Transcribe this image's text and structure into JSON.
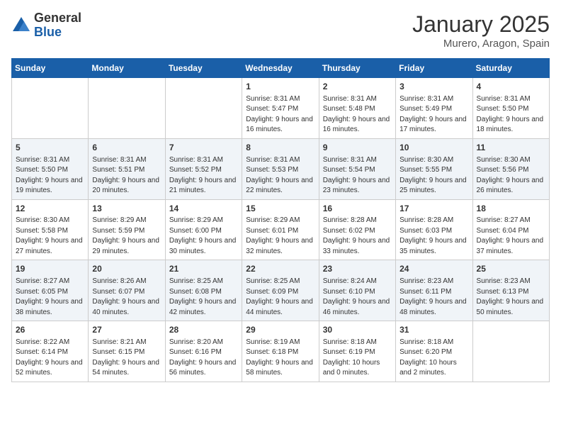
{
  "logo": {
    "general": "General",
    "blue": "Blue"
  },
  "title": {
    "month": "January 2025",
    "location": "Murero, Aragon, Spain"
  },
  "days_of_week": [
    "Sunday",
    "Monday",
    "Tuesday",
    "Wednesday",
    "Thursday",
    "Friday",
    "Saturday"
  ],
  "weeks": [
    [
      {
        "day": "",
        "sunrise": "",
        "sunset": "",
        "daylight": ""
      },
      {
        "day": "",
        "sunrise": "",
        "sunset": "",
        "daylight": ""
      },
      {
        "day": "",
        "sunrise": "",
        "sunset": "",
        "daylight": ""
      },
      {
        "day": "1",
        "sunrise": "Sunrise: 8:31 AM",
        "sunset": "Sunset: 5:47 PM",
        "daylight": "Daylight: 9 hours and 16 minutes."
      },
      {
        "day": "2",
        "sunrise": "Sunrise: 8:31 AM",
        "sunset": "Sunset: 5:48 PM",
        "daylight": "Daylight: 9 hours and 16 minutes."
      },
      {
        "day": "3",
        "sunrise": "Sunrise: 8:31 AM",
        "sunset": "Sunset: 5:49 PM",
        "daylight": "Daylight: 9 hours and 17 minutes."
      },
      {
        "day": "4",
        "sunrise": "Sunrise: 8:31 AM",
        "sunset": "Sunset: 5:50 PM",
        "daylight": "Daylight: 9 hours and 18 minutes."
      }
    ],
    [
      {
        "day": "5",
        "sunrise": "Sunrise: 8:31 AM",
        "sunset": "Sunset: 5:50 PM",
        "daylight": "Daylight: 9 hours and 19 minutes."
      },
      {
        "day": "6",
        "sunrise": "Sunrise: 8:31 AM",
        "sunset": "Sunset: 5:51 PM",
        "daylight": "Daylight: 9 hours and 20 minutes."
      },
      {
        "day": "7",
        "sunrise": "Sunrise: 8:31 AM",
        "sunset": "Sunset: 5:52 PM",
        "daylight": "Daylight: 9 hours and 21 minutes."
      },
      {
        "day": "8",
        "sunrise": "Sunrise: 8:31 AM",
        "sunset": "Sunset: 5:53 PM",
        "daylight": "Daylight: 9 hours and 22 minutes."
      },
      {
        "day": "9",
        "sunrise": "Sunrise: 8:31 AM",
        "sunset": "Sunset: 5:54 PM",
        "daylight": "Daylight: 9 hours and 23 minutes."
      },
      {
        "day": "10",
        "sunrise": "Sunrise: 8:30 AM",
        "sunset": "Sunset: 5:55 PM",
        "daylight": "Daylight: 9 hours and 25 minutes."
      },
      {
        "day": "11",
        "sunrise": "Sunrise: 8:30 AM",
        "sunset": "Sunset: 5:56 PM",
        "daylight": "Daylight: 9 hours and 26 minutes."
      }
    ],
    [
      {
        "day": "12",
        "sunrise": "Sunrise: 8:30 AM",
        "sunset": "Sunset: 5:58 PM",
        "daylight": "Daylight: 9 hours and 27 minutes."
      },
      {
        "day": "13",
        "sunrise": "Sunrise: 8:29 AM",
        "sunset": "Sunset: 5:59 PM",
        "daylight": "Daylight: 9 hours and 29 minutes."
      },
      {
        "day": "14",
        "sunrise": "Sunrise: 8:29 AM",
        "sunset": "Sunset: 6:00 PM",
        "daylight": "Daylight: 9 hours and 30 minutes."
      },
      {
        "day": "15",
        "sunrise": "Sunrise: 8:29 AM",
        "sunset": "Sunset: 6:01 PM",
        "daylight": "Daylight: 9 hours and 32 minutes."
      },
      {
        "day": "16",
        "sunrise": "Sunrise: 8:28 AM",
        "sunset": "Sunset: 6:02 PM",
        "daylight": "Daylight: 9 hours and 33 minutes."
      },
      {
        "day": "17",
        "sunrise": "Sunrise: 8:28 AM",
        "sunset": "Sunset: 6:03 PM",
        "daylight": "Daylight: 9 hours and 35 minutes."
      },
      {
        "day": "18",
        "sunrise": "Sunrise: 8:27 AM",
        "sunset": "Sunset: 6:04 PM",
        "daylight": "Daylight: 9 hours and 37 minutes."
      }
    ],
    [
      {
        "day": "19",
        "sunrise": "Sunrise: 8:27 AM",
        "sunset": "Sunset: 6:05 PM",
        "daylight": "Daylight: 9 hours and 38 minutes."
      },
      {
        "day": "20",
        "sunrise": "Sunrise: 8:26 AM",
        "sunset": "Sunset: 6:07 PM",
        "daylight": "Daylight: 9 hours and 40 minutes."
      },
      {
        "day": "21",
        "sunrise": "Sunrise: 8:25 AM",
        "sunset": "Sunset: 6:08 PM",
        "daylight": "Daylight: 9 hours and 42 minutes."
      },
      {
        "day": "22",
        "sunrise": "Sunrise: 8:25 AM",
        "sunset": "Sunset: 6:09 PM",
        "daylight": "Daylight: 9 hours and 44 minutes."
      },
      {
        "day": "23",
        "sunrise": "Sunrise: 8:24 AM",
        "sunset": "Sunset: 6:10 PM",
        "daylight": "Daylight: 9 hours and 46 minutes."
      },
      {
        "day": "24",
        "sunrise": "Sunrise: 8:23 AM",
        "sunset": "Sunset: 6:11 PM",
        "daylight": "Daylight: 9 hours and 48 minutes."
      },
      {
        "day": "25",
        "sunrise": "Sunrise: 8:23 AM",
        "sunset": "Sunset: 6:13 PM",
        "daylight": "Daylight: 9 hours and 50 minutes."
      }
    ],
    [
      {
        "day": "26",
        "sunrise": "Sunrise: 8:22 AM",
        "sunset": "Sunset: 6:14 PM",
        "daylight": "Daylight: 9 hours and 52 minutes."
      },
      {
        "day": "27",
        "sunrise": "Sunrise: 8:21 AM",
        "sunset": "Sunset: 6:15 PM",
        "daylight": "Daylight: 9 hours and 54 minutes."
      },
      {
        "day": "28",
        "sunrise": "Sunrise: 8:20 AM",
        "sunset": "Sunset: 6:16 PM",
        "daylight": "Daylight: 9 hours and 56 minutes."
      },
      {
        "day": "29",
        "sunrise": "Sunrise: 8:19 AM",
        "sunset": "Sunset: 6:18 PM",
        "daylight": "Daylight: 9 hours and 58 minutes."
      },
      {
        "day": "30",
        "sunrise": "Sunrise: 8:18 AM",
        "sunset": "Sunset: 6:19 PM",
        "daylight": "Daylight: 10 hours and 0 minutes."
      },
      {
        "day": "31",
        "sunrise": "Sunrise: 8:18 AM",
        "sunset": "Sunset: 6:20 PM",
        "daylight": "Daylight: 10 hours and 2 minutes."
      },
      {
        "day": "",
        "sunrise": "",
        "sunset": "",
        "daylight": ""
      }
    ]
  ]
}
